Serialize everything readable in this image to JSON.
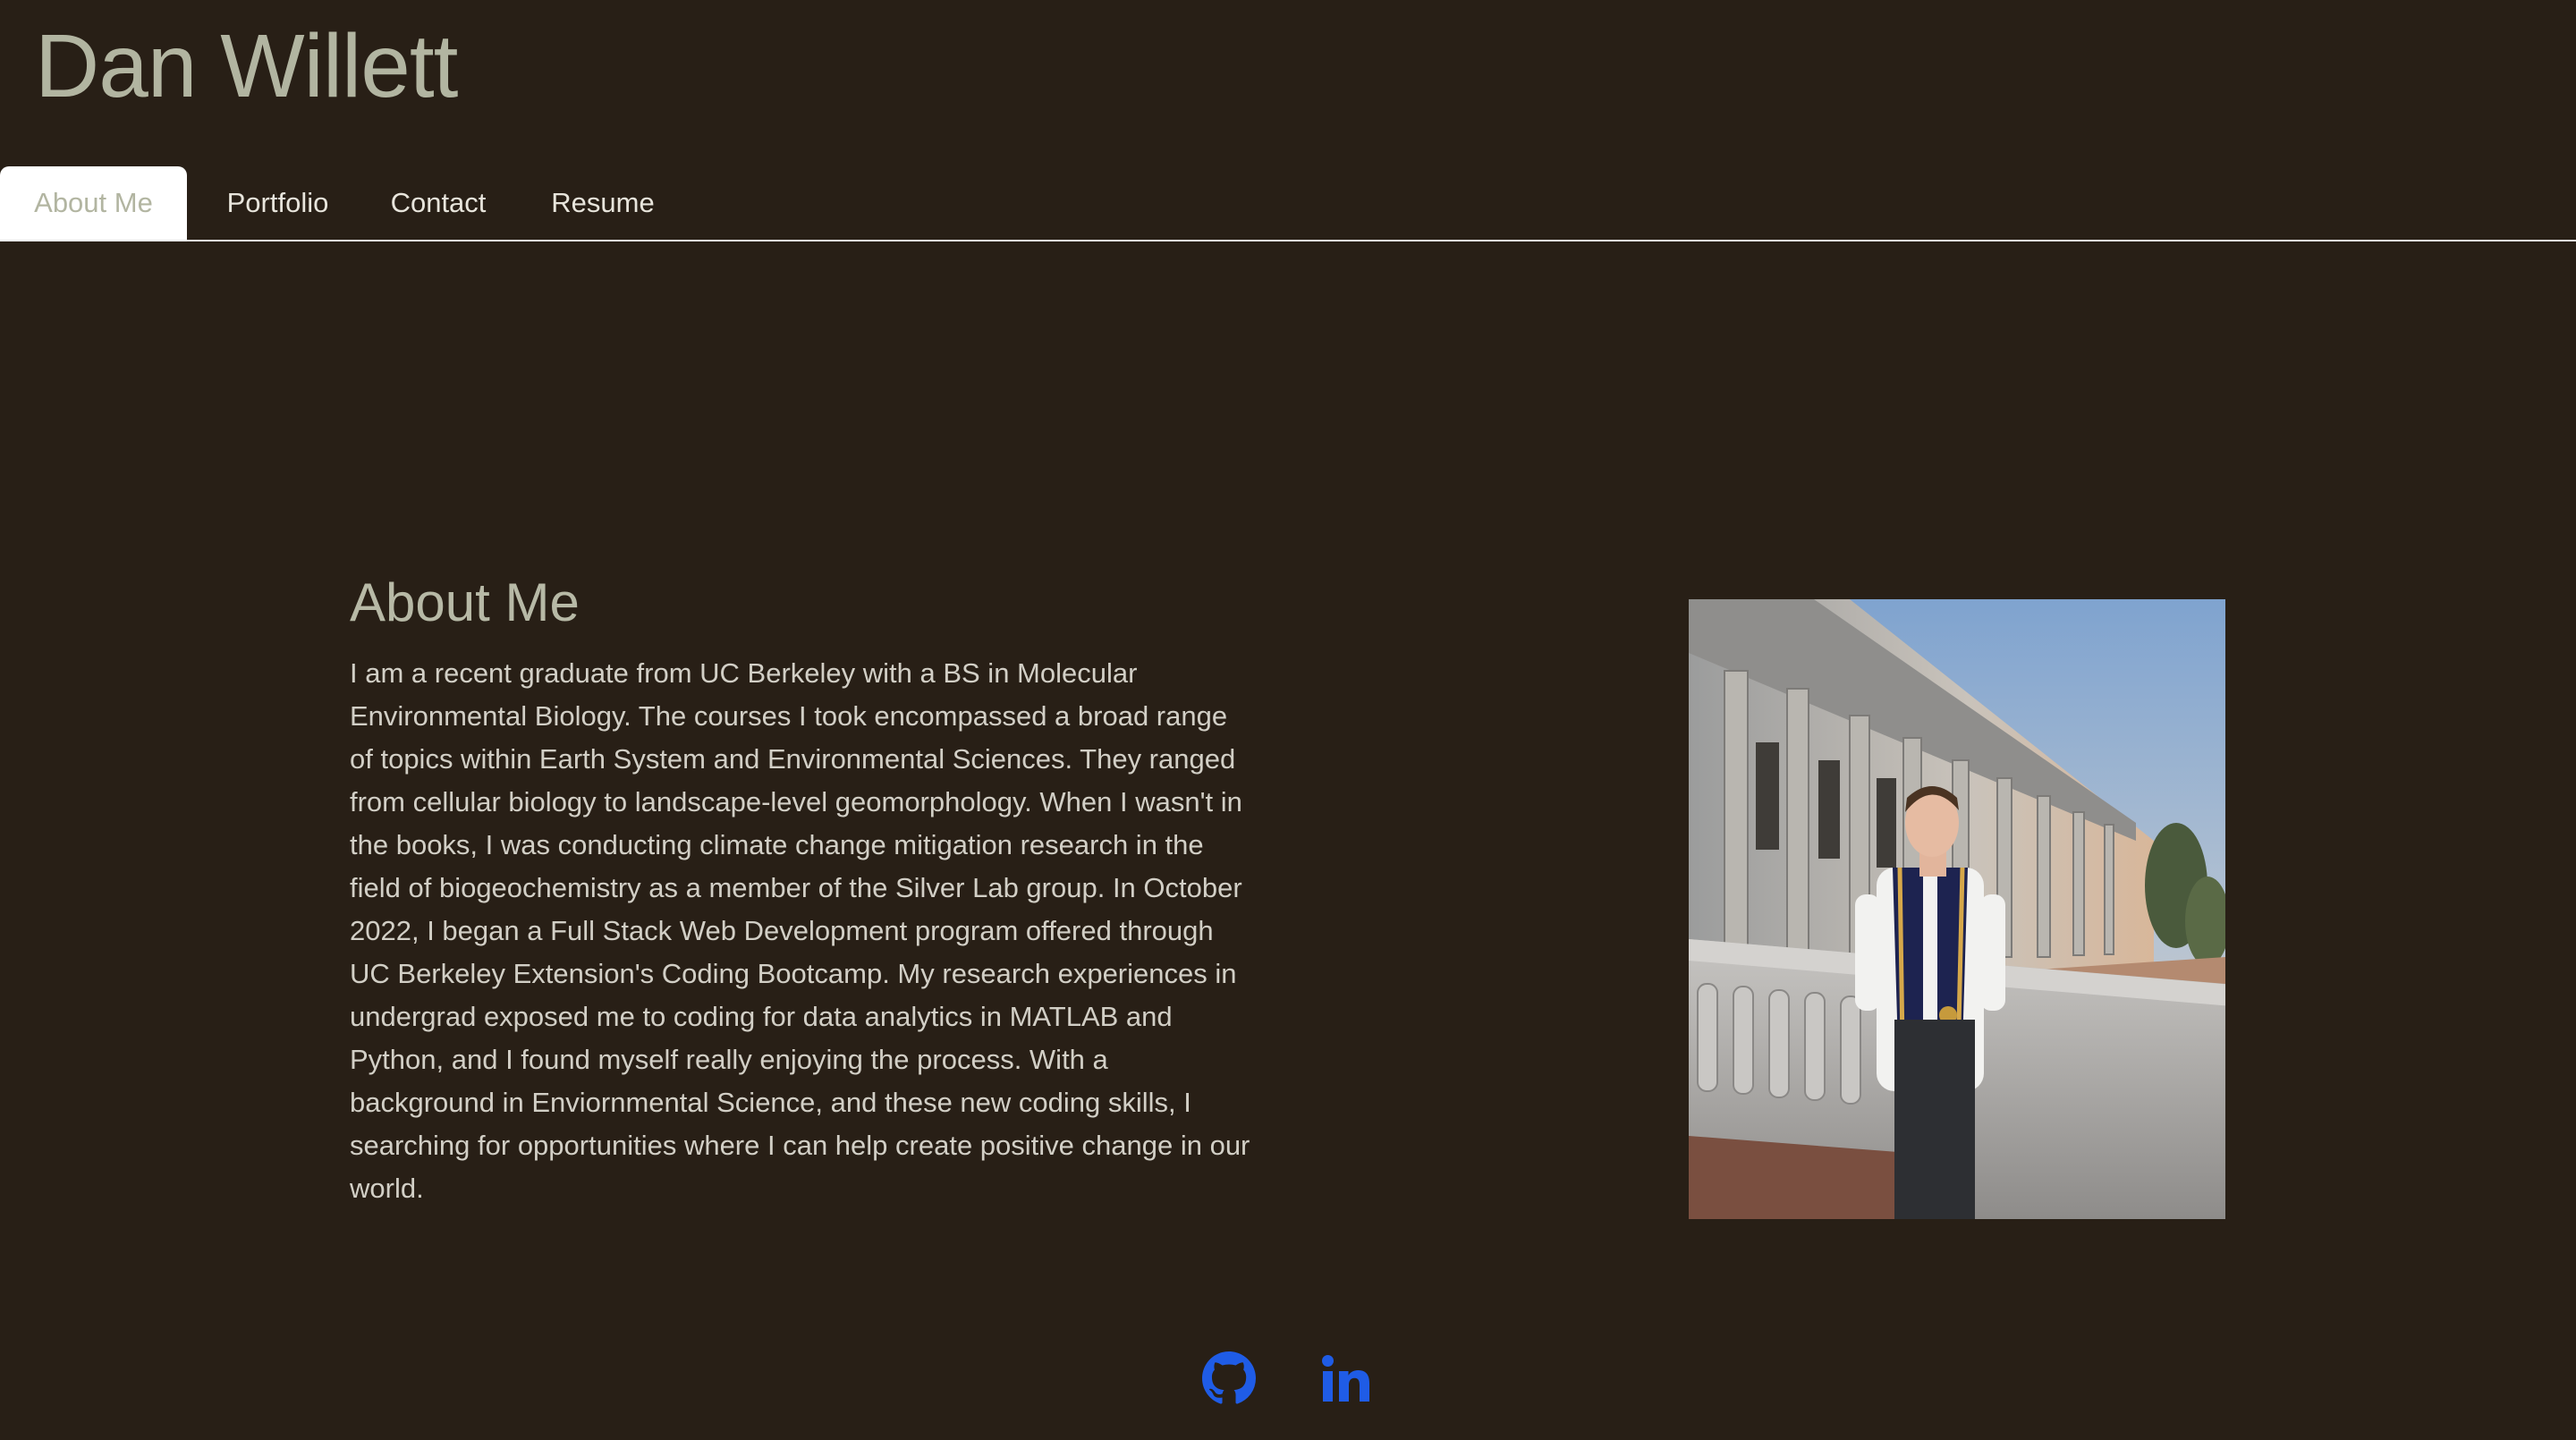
{
  "site": {
    "title": "Dan Willett"
  },
  "nav": {
    "tabs": [
      {
        "label": "About Me",
        "active": true
      },
      {
        "label": "Portfolio",
        "active": false
      },
      {
        "label": "Contact",
        "active": false
      },
      {
        "label": "Resume",
        "active": false
      }
    ]
  },
  "about": {
    "heading": "About Me",
    "body": "I am a recent graduate from UC Berkeley with a BS in Molecular Environmental Biology. The courses I took encompassed a broad range of topics within Earth System and Environmental Sciences. They ranged from cellular biology to landscape-level geomorphology. When I wasn't in the books, I was conducting climate change mitigation research in the field of biogeochemistry as a member of the Silver Lab group. In October 2022, I began a Full Stack Web Development program offered through UC Berkeley Extension's Coding Bootcamp. My research experiences in undergrad exposed me to coding for data analytics in MATLAB and Python, and I found myself really enjoying the process. With a background in Enviornmental Science, and these new coding skills, I searching for opportunities where I can help create positive change in our world."
  },
  "photo": {
    "subject": "graduate-portrait"
  },
  "footer": {
    "icons": [
      {
        "icon": "github-icon"
      },
      {
        "icon": "linkedin-icon"
      }
    ],
    "icon_color": "#1f5ce6"
  },
  "colors": {
    "background": "#281f16",
    "title": "#b2b5a1",
    "text": "#d2cfc6",
    "nav_active_bg": "#ffffff"
  }
}
